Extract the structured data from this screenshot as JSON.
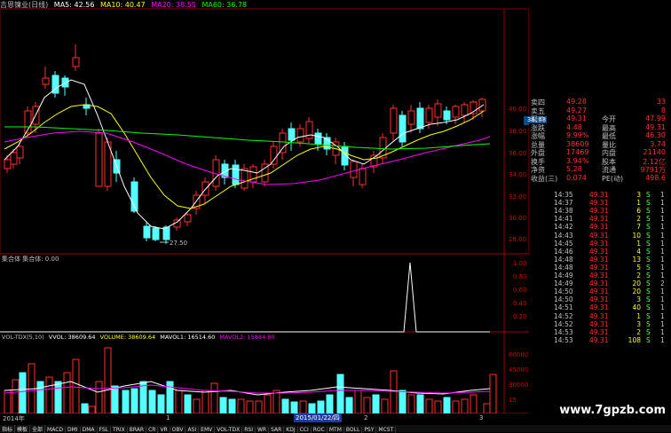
{
  "header": {
    "stock_name": "吉恩镍业(日线)",
    "ma5": "MA5: 42.56",
    "ma10": "MA10: 40.47",
    "ma20": "MA20: 38.55",
    "ma60": "MA60: 36.78",
    "colors": {
      "ma5": "#ffffff",
      "ma10": "#ffff00",
      "ma20": "#ff00ff",
      "ma60": "#00ff00"
    }
  },
  "price_axis": [
    "40.00",
    "38.00",
    "36.00",
    "34.00",
    "32.00",
    "30.00",
    "28.00"
  ],
  "current_price_tag": "38.48",
  "low_marker": "27.50",
  "indicator1": {
    "title": "集合体 集合体: 0.00",
    "axis": [
      "1.00",
      "0.80",
      "0.60",
      "0.40",
      "0.20"
    ]
  },
  "indicator2": {
    "title": "VOL-TDX(5,10)",
    "vvol": "VVOL: 38609.64",
    "volume": "VOLUME: 38609.64",
    "mavol1": "MAVOL1: 16514.60",
    "mavol2": "MAVOL2: 15884.80",
    "axis": [
      "60000",
      "45000",
      "30000",
      "15"
    ]
  },
  "dates": {
    "left": "2014年",
    "mid1": "1",
    "highlight": "2015/01/22/四",
    "mid2": "2",
    "mid3": "3"
  },
  "quote": {
    "rows": [
      {
        "l": "卖四",
        "v": "49.28",
        "r": "",
        "rv": "33"
      },
      {
        "l": "卖五",
        "v": "49.27",
        "r": "",
        "rv": "8"
      },
      {
        "l": "现价",
        "v": "49.31",
        "r": "今开",
        "rv": "47.99"
      },
      {
        "l": "涨跌",
        "v": "4.48",
        "r": "最高",
        "rv": "49.31"
      },
      {
        "l": "涨幅",
        "v": "9.99%",
        "r": "最低",
        "rv": "46.30"
      },
      {
        "l": "总量",
        "v": "38609",
        "r": "量比",
        "rv": "3.74"
      },
      {
        "l": "外盘",
        "v": "17469",
        "r": "内盘",
        "rv": "21140"
      },
      {
        "l": "换手",
        "v": "3.94%",
        "r": "股本",
        "rv": "2.12亿"
      },
      {
        "l": "净资",
        "v": "5.28",
        "r": "流通",
        "rv": "9791万"
      },
      {
        "l": "收益(三)",
        "v": "0.074",
        "r": "PE(动)",
        "rv": "498.6"
      }
    ]
  },
  "ticks": [
    {
      "t": "14:35",
      "p": "49.31",
      "v": "3",
      "s": "S",
      "n": "1"
    },
    {
      "t": "14:37",
      "p": "49.31",
      "v": "1",
      "s": "S",
      "n": "1"
    },
    {
      "t": "14:38",
      "p": "49.31",
      "v": "6",
      "s": "S",
      "n": "1"
    },
    {
      "t": "14:41",
      "p": "49.31",
      "v": "2",
      "s": "S",
      "n": "1"
    },
    {
      "t": "14:42",
      "p": "49.31",
      "v": "7",
      "s": "S",
      "n": "1"
    },
    {
      "t": "14:43",
      "p": "49.31",
      "v": "10",
      "s": "S",
      "n": "1"
    },
    {
      "t": "14:45",
      "p": "49.31",
      "v": "1",
      "s": "S",
      "n": "1"
    },
    {
      "t": "14:46",
      "p": "49.31",
      "v": "4",
      "s": "S",
      "n": "1"
    },
    {
      "t": "14:48",
      "p": "49.31",
      "v": "13",
      "s": "S",
      "n": "1"
    },
    {
      "t": "14:48",
      "p": "49.31",
      "v": "5",
      "s": "S",
      "n": "1"
    },
    {
      "t": "14:49",
      "p": "49.31",
      "v": "2",
      "s": "S",
      "n": "1"
    },
    {
      "t": "14:49",
      "p": "49.31",
      "v": "20",
      "s": "S",
      "n": "2"
    },
    {
      "t": "14:50",
      "p": "49.31",
      "v": "20",
      "s": "S",
      "n": "1"
    },
    {
      "t": "14:50",
      "p": "49.31",
      "v": "3",
      "s": "S",
      "n": "1"
    },
    {
      "t": "14:51",
      "p": "49.31",
      "v": "40",
      "s": "S",
      "n": "1"
    },
    {
      "t": "14:52",
      "p": "49.31",
      "v": "1",
      "s": "S",
      "n": "1"
    },
    {
      "t": "14:52",
      "p": "49.31",
      "v": "3",
      "s": "S",
      "n": "1"
    },
    {
      "t": "14:53",
      "p": "49.31",
      "v": "2",
      "s": "S",
      "n": "1"
    },
    {
      "t": "14:53",
      "p": "49.31",
      "v": "108",
      "s": "S",
      "n": "1"
    }
  ],
  "bottom_tabs": [
    "指标",
    "模板",
    "全部",
    "MACD",
    "DMI",
    "DMA",
    "FSL",
    "TRIX",
    "BRAR",
    "CR",
    "VR",
    "OBV",
    "ASI",
    "EMV",
    "VOL-TDX",
    "RSI",
    "WR",
    "SAR",
    "KDJ",
    "CCI",
    "ROC",
    "MTM",
    "BOLL",
    "PSY",
    "MCST"
  ],
  "watermark": "www.7gpzb.com"
}
